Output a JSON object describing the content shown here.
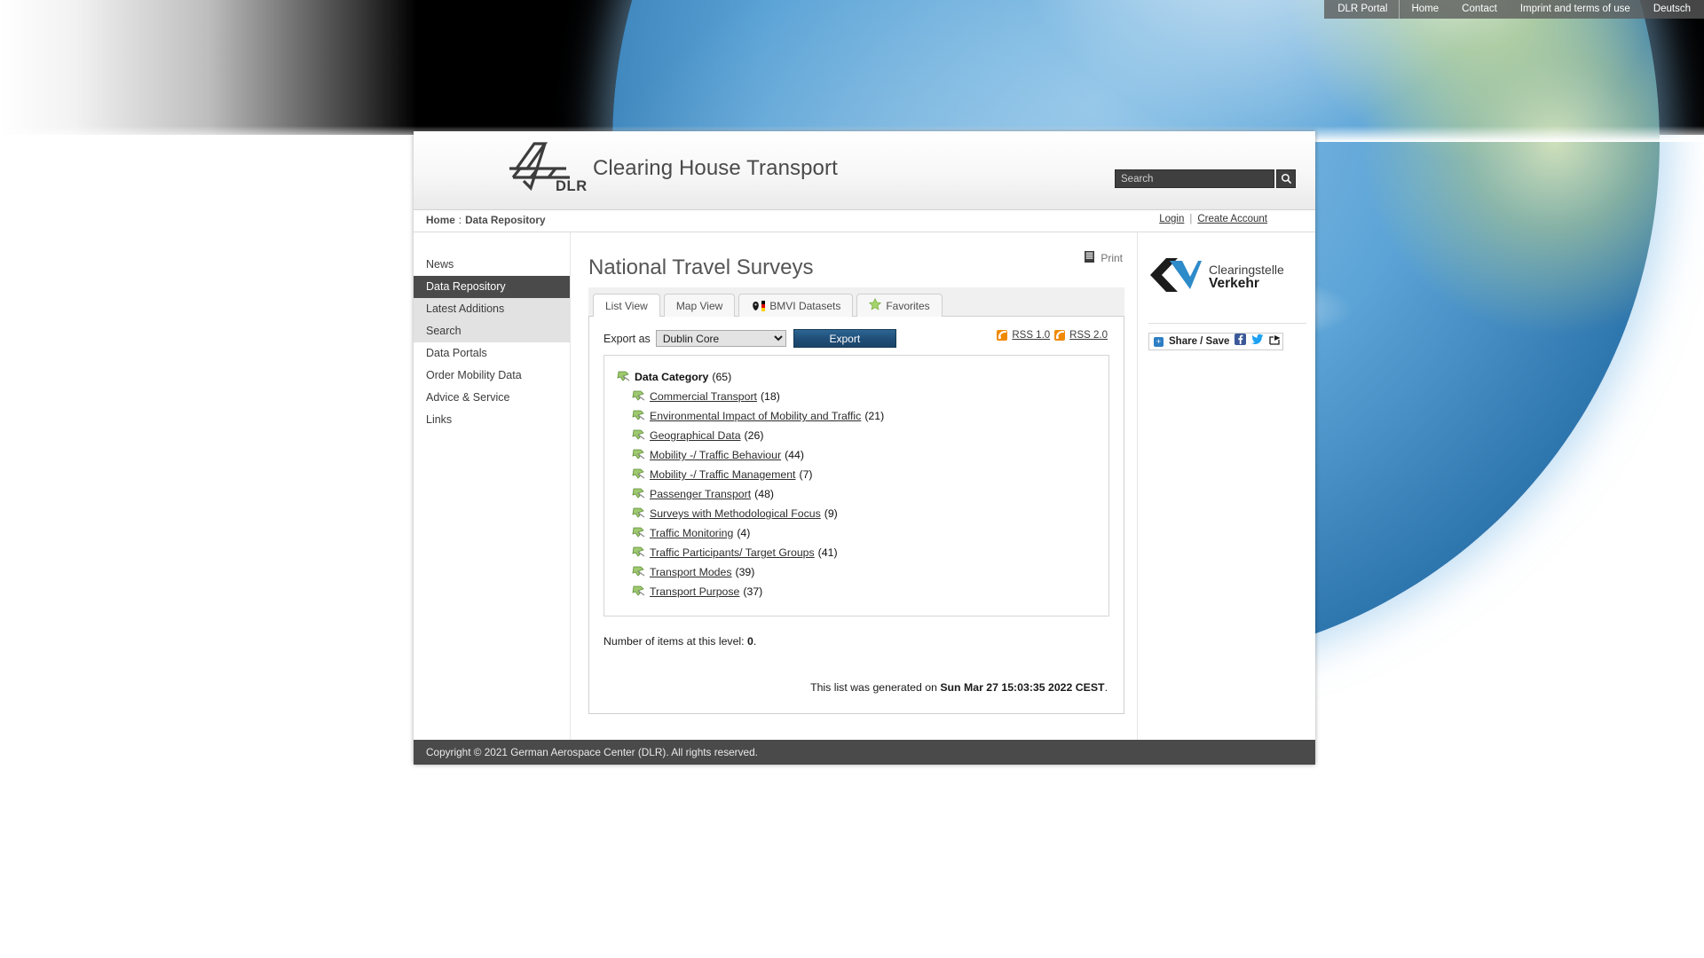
{
  "topnav": {
    "items": [
      {
        "label": "DLR Portal",
        "name": "topnav-dlr-portal"
      },
      {
        "label": "Home",
        "name": "topnav-home"
      },
      {
        "label": "Contact",
        "name": "topnav-contact"
      },
      {
        "label": "Imprint and terms of use",
        "name": "topnav-imprint"
      },
      {
        "label": "Deutsch",
        "name": "topnav-deutsch"
      }
    ]
  },
  "header": {
    "logo_word": "DLR",
    "site_title": "Clearing House Transport",
    "search": {
      "placeholder": "Search",
      "value": "",
      "icon": "search-icon"
    }
  },
  "breadcrumb": {
    "home": "Home",
    "separator": ":",
    "current": "Data Repository"
  },
  "account": {
    "login": "Login",
    "divider": "|",
    "create_account": "Create Account"
  },
  "sidebar": {
    "items": [
      {
        "label": "News",
        "state": "normal"
      },
      {
        "label": "Data Repository",
        "state": "active"
      },
      {
        "label": "Latest Additions",
        "state": "shade"
      },
      {
        "label": "Search",
        "state": "shade"
      },
      {
        "label": "Data Portals",
        "state": "normal"
      },
      {
        "label": "Order Mobility Data",
        "state": "normal"
      },
      {
        "label": "Advice & Service",
        "state": "normal"
      },
      {
        "label": "Links",
        "state": "normal"
      }
    ]
  },
  "main": {
    "print_label": "Print",
    "print_icon": "printer-icon",
    "page_title": "National Travel Surveys",
    "tabs": [
      {
        "label": "List View",
        "active": true,
        "icon": null
      },
      {
        "label": "Map View",
        "active": false,
        "icon": null
      },
      {
        "label": "BMVI Datasets",
        "active": false,
        "icon": "german-flag-icon"
      },
      {
        "label": "Favorites",
        "active": false,
        "icon": "star-icon"
      }
    ],
    "export": {
      "label": "Export as",
      "selected": "Dublin Core",
      "options": [
        "Dublin Core"
      ],
      "button": "Export"
    },
    "rss": [
      {
        "label": "RSS 1.0",
        "icon": "rss-icon"
      },
      {
        "label": "RSS 2.0",
        "icon": "rss-icon"
      }
    ],
    "tree": {
      "root": {
        "label": "Data Category",
        "count": "(65)",
        "icon": "pushpin-icon"
      },
      "children": [
        {
          "label": "Commercial Transport",
          "count": "(18)"
        },
        {
          "label": "Environmental Impact of Mobility and Traffic",
          "count": "(21)"
        },
        {
          "label": "Geographical Data",
          "count": "(26)"
        },
        {
          "label": "Mobility -/ Traffic Behaviour",
          "count": "(44)"
        },
        {
          "label": "Mobility -/ Traffic Management",
          "count": "(7)"
        },
        {
          "label": "Passenger Transport",
          "count": "(48)"
        },
        {
          "label": "Surveys with Methodological Focus",
          "count": "(9)"
        },
        {
          "label": "Traffic Monitoring",
          "count": "(4)"
        },
        {
          "label": "Traffic Participants/ Target Groups",
          "count": "(41)"
        },
        {
          "label": "Transport Modes",
          "count": "(39)"
        },
        {
          "label": "Transport Purpose",
          "count": "(37)"
        }
      ]
    },
    "item_count_prefix": "Number of items at this level:",
    "item_count_value": "0",
    "item_count_suffix": ".",
    "generated_prefix": "This list was generated on",
    "generated_timestamp": "Sun Mar 27 15:03:35 2022 CEST",
    "generated_suffix": "."
  },
  "rightrail": {
    "logo_line1": "Clearingstelle",
    "logo_line2": "Verkehr",
    "share": {
      "label": "Share / Save",
      "plus_glyph": "+",
      "icons": [
        "facebook-icon",
        "twitter-icon",
        "share-arrow-icon"
      ]
    }
  },
  "footer": {
    "copyright": "Copyright © 2021 German Aerospace Center (DLR). All rights reserved."
  },
  "colors": {
    "accent_blue": "#1f4e78",
    "sidebar_active": "#4a4a4a",
    "rss_orange": "#f08a00",
    "cv_blue": "#2e8bc9",
    "facebook": "#3b5998",
    "twitter": "#1da1f2"
  }
}
